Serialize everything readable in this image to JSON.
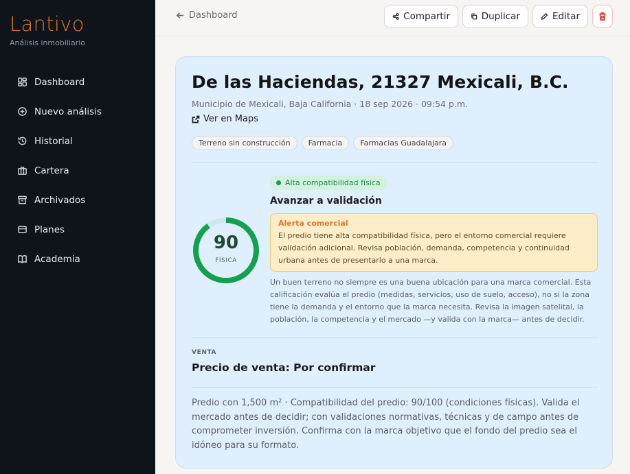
{
  "brand": {
    "name": "Lantivo",
    "subtitle": "Análisis inmobiliario"
  },
  "sidebar": {
    "items": [
      {
        "label": "Dashboard",
        "icon": "dashboard-icon"
      },
      {
        "label": "Nuevo análisis",
        "icon": "plus-circle-icon"
      },
      {
        "label": "Historial",
        "icon": "history-icon"
      },
      {
        "label": "Cartera",
        "icon": "briefcase-icon"
      },
      {
        "label": "Archivados",
        "icon": "archive-icon"
      },
      {
        "label": "Planes",
        "icon": "credit-card-icon"
      },
      {
        "label": "Academia",
        "icon": "book-icon"
      }
    ]
  },
  "topbar": {
    "back_label": "Dashboard",
    "share_label": "Compartir",
    "duplicate_label": "Duplicar",
    "edit_label": "Editar"
  },
  "property": {
    "title": "De las Haciendas, 21327 Mexicali, B.C.",
    "meta": "Municipio de Mexicali, Baja California  ·  18 sep 2026 · 09:54 p.m.",
    "maps_label": "Ver en Maps",
    "tags": [
      "Terreno sin construcción",
      "Farmacia",
      "Farmacias Guadalajara"
    ]
  },
  "score": {
    "value": "90",
    "max": 100,
    "label": "FÍSICA",
    "badge": "Alta compatibilidad física",
    "recommendation": "Avanzar a validación",
    "colors": {
      "ring": "#15a04f",
      "track": "#cde8ef"
    }
  },
  "alert": {
    "title": "Alerta comercial",
    "body": "El predio tiene alta compatibilidad física, pero el entorno comercial requiere validación adicional. Revisa población, demanda, competencia y continuidad urbana antes de presentarlo a una marca."
  },
  "note": "Un buen terreno no siempre es una buena ubicación para una marca comercial. Esta calificación evalúa el predio (medidas, servicios, uso de suelo, acceso), no si la zona tiene la demanda y el entorno que la marca necesita. Revisa la imagen satelital, la población, la competencia y el mercado —y valida con la marca— antes de decidir.",
  "sale": {
    "section_label": "VENTA",
    "price_label": "Precio de venta: Por confirmar"
  },
  "description": "Predio con 1,500 m² · Compatibilidad del predio: 90/100 (condiciones físicas). Valida el mercado antes de decidir; con validaciones normativas, técnicas y de campo antes de comprometer inversión. Confirma con la marca objetivo que el fondo del predio sea el idóneo para su formato."
}
